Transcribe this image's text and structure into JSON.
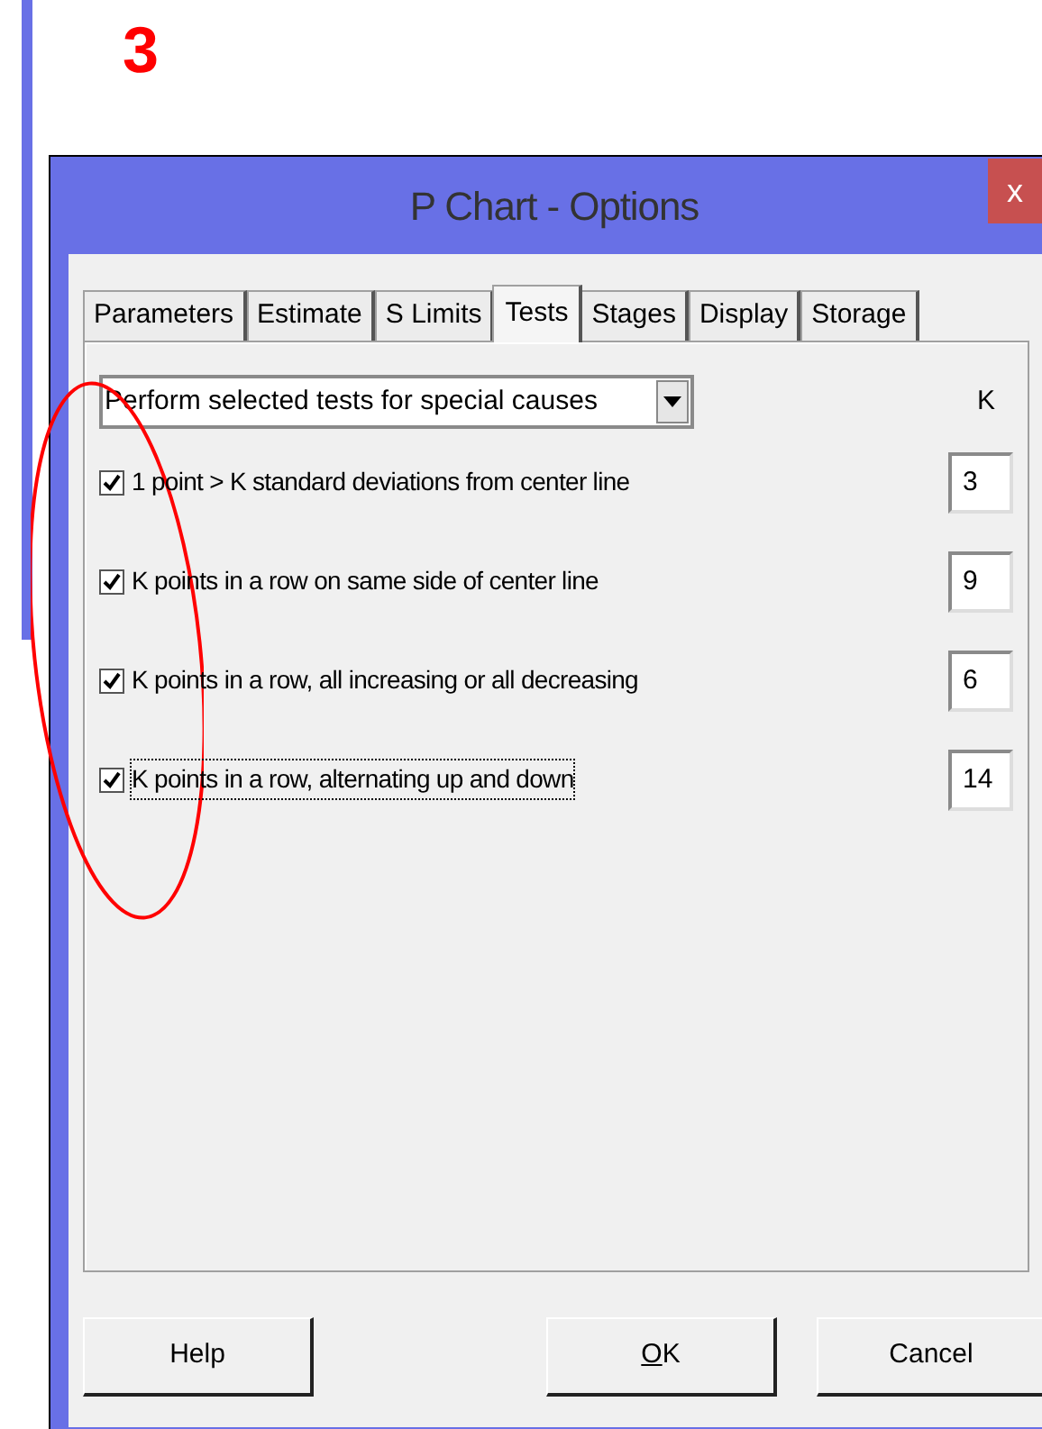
{
  "slide": {
    "number": "3"
  },
  "window": {
    "title": "P Chart - Options",
    "close": "x"
  },
  "tabs": [
    {
      "label": "Parameters",
      "selected": false
    },
    {
      "label": "Estimate",
      "selected": false
    },
    {
      "label": "S Limits",
      "selected": false
    },
    {
      "label": "Tests",
      "selected": true
    },
    {
      "label": "Stages",
      "selected": false
    },
    {
      "label": "Display",
      "selected": false
    },
    {
      "label": "Storage",
      "selected": false
    }
  ],
  "test_mode": {
    "value": "Perform selected tests for special causes"
  },
  "k_header": "K",
  "tests": [
    {
      "label": "1 point > K standard deviations from center line",
      "checked": true,
      "focused": false,
      "k": "3"
    },
    {
      "label": "K points in a row on same side of center line",
      "checked": true,
      "focused": false,
      "k": "9"
    },
    {
      "label": "K points in a row, all increasing or all decreasing",
      "checked": true,
      "focused": false,
      "k": "6"
    },
    {
      "label": "K points in a row, alternating up and down",
      "checked": true,
      "focused": true,
      "k": "14"
    }
  ],
  "buttons": [
    {
      "label": "Help",
      "first_letter_underlined": false
    },
    {
      "label": "OK",
      "first_letter_underlined": true
    },
    {
      "label": "Cancel",
      "first_letter_underlined": false
    }
  ]
}
